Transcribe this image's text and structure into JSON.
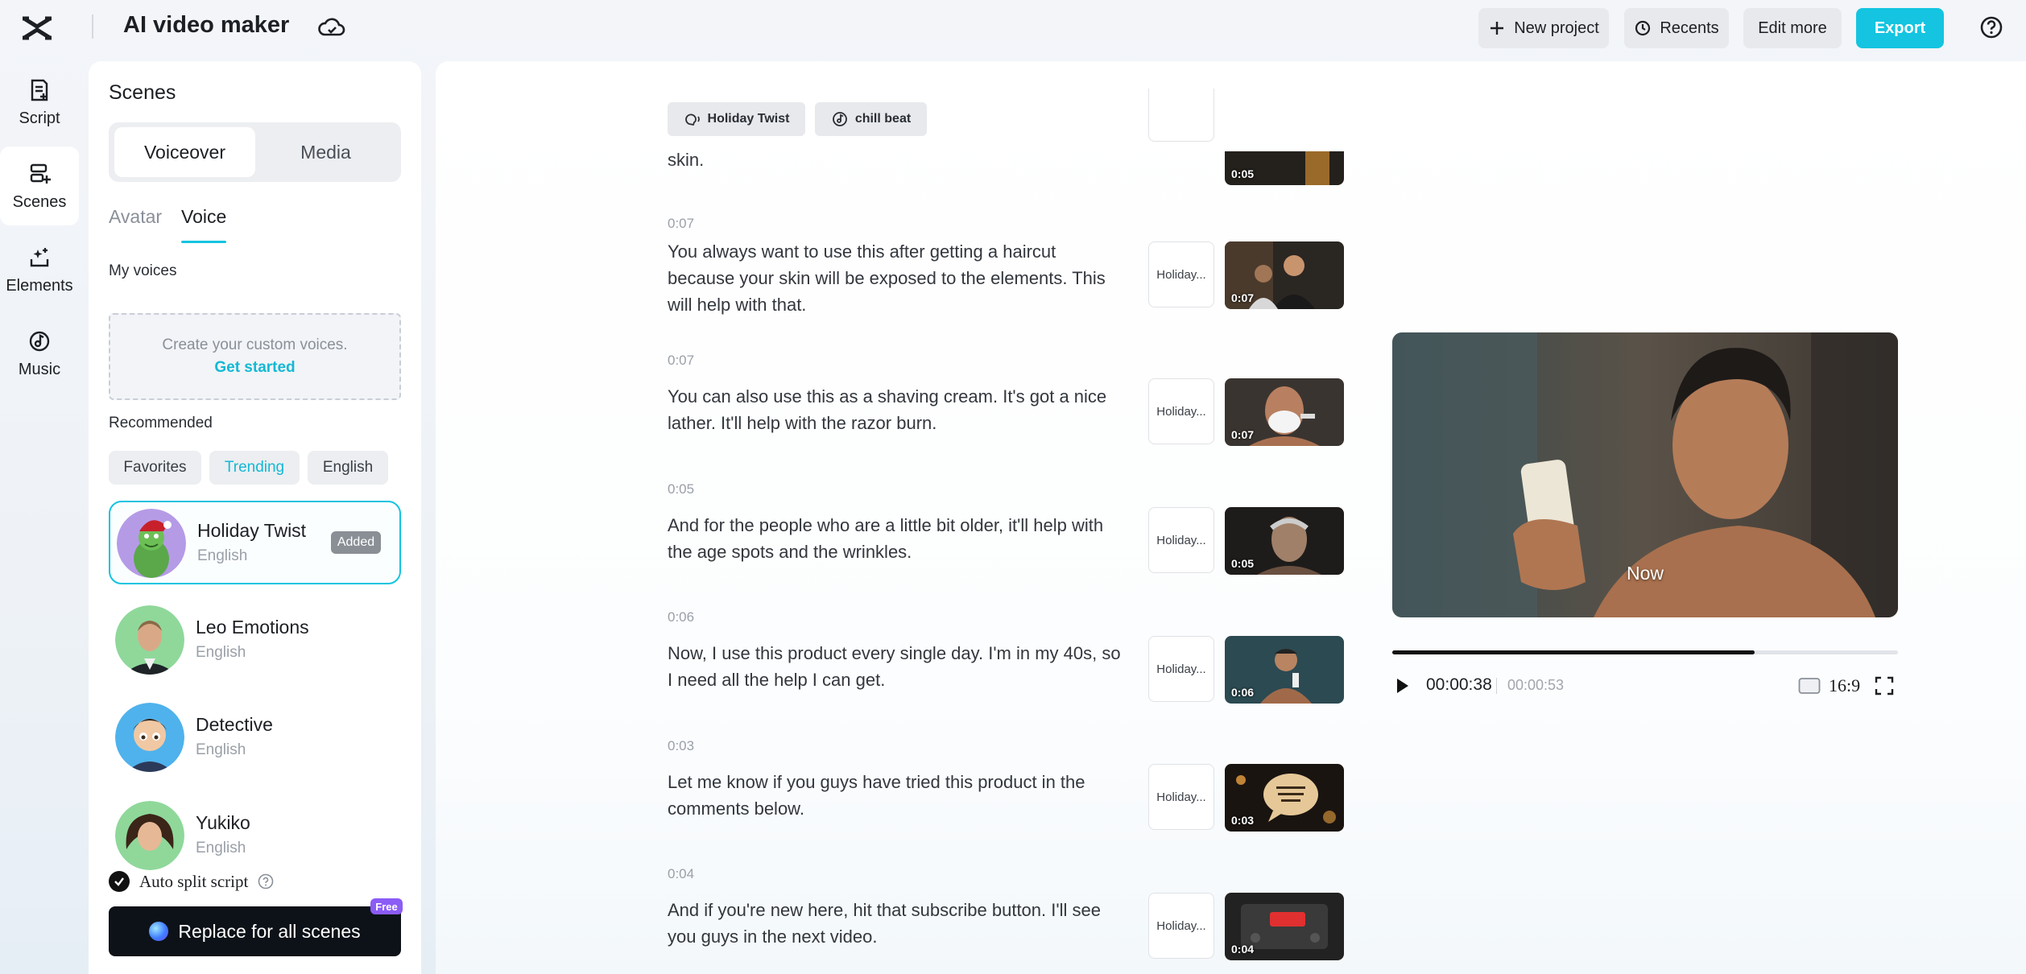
{
  "app": {
    "title": "AI video maker"
  },
  "toolbar": {
    "new_project": "New project",
    "recents": "Recents",
    "edit_more": "Edit more",
    "export": "Export"
  },
  "rail": [
    {
      "label": "Script",
      "icon": "script-icon"
    },
    {
      "label": "Scenes",
      "icon": "scenes-icon",
      "active": true
    },
    {
      "label": "Elements",
      "icon": "elements-icon"
    },
    {
      "label": "Music",
      "icon": "music-icon"
    }
  ],
  "panel": {
    "title": "Scenes",
    "segments": {
      "voiceover": "Voiceover",
      "media": "Media"
    },
    "subtabs": {
      "avatar": "Avatar",
      "voice": "Voice"
    },
    "my_voices": "My voices",
    "custom_text": "Create your custom voices.",
    "custom_link": "Get started",
    "recommended": "Recommended",
    "chips": [
      "Favorites",
      "Trending",
      "English"
    ],
    "voices": [
      {
        "name": "Holiday Twist",
        "lang": "English",
        "badge": "Added",
        "selected": true
      },
      {
        "name": "Leo Emotions",
        "lang": "English"
      },
      {
        "name": "Detective",
        "lang": "English"
      },
      {
        "name": "Yukiko",
        "lang": "English"
      }
    ],
    "auto_split": "Auto split script",
    "replace_btn": "Replace for all scenes",
    "free_badge": "Free"
  },
  "tags": {
    "voice": "Holiday Twist",
    "music": "chill beat"
  },
  "scenes": [
    {
      "time": "",
      "text": "skin.",
      "voice": "",
      "dur": "0:05"
    },
    {
      "time": "0:07",
      "text": "You always want to use this after getting a haircut because your skin will be exposed to the elements. This will help with that.",
      "voice": "Holiday...",
      "dur": "0:07"
    },
    {
      "time": "0:07",
      "text": "You can also use this as a shaving cream. It's got a nice lather. It'll help with the razor burn.",
      "voice": "Holiday...",
      "dur": "0:07"
    },
    {
      "time": "0:05",
      "text": "And for the people who are a little bit older, it'll help with the age spots and the wrinkles.",
      "voice": "Holiday...",
      "dur": "0:05"
    },
    {
      "time": "0:06",
      "text": "Now, I use this product every single day. I'm in my 40s, so I need all the help I can get.",
      "voice": "Holiday...",
      "dur": "0:06"
    },
    {
      "time": "0:03",
      "text": "Let me know if you guys have tried this product in the comments below.",
      "voice": "Holiday...",
      "dur": "0:03"
    },
    {
      "time": "0:04",
      "text": "And if you're new here, hit that subscribe button. I'll see you guys in the next video.",
      "voice": "Holiday...",
      "dur": "0:04"
    }
  ],
  "preview": {
    "caption": "Now",
    "current_time": "00:00:38",
    "total_time": "00:00:53",
    "progress_fraction": 0.717,
    "ratio": "16:9"
  },
  "colors": {
    "accent": "#14c4e0",
    "dark_button": "#0d1218",
    "free_badge": "#8b5cf6"
  }
}
